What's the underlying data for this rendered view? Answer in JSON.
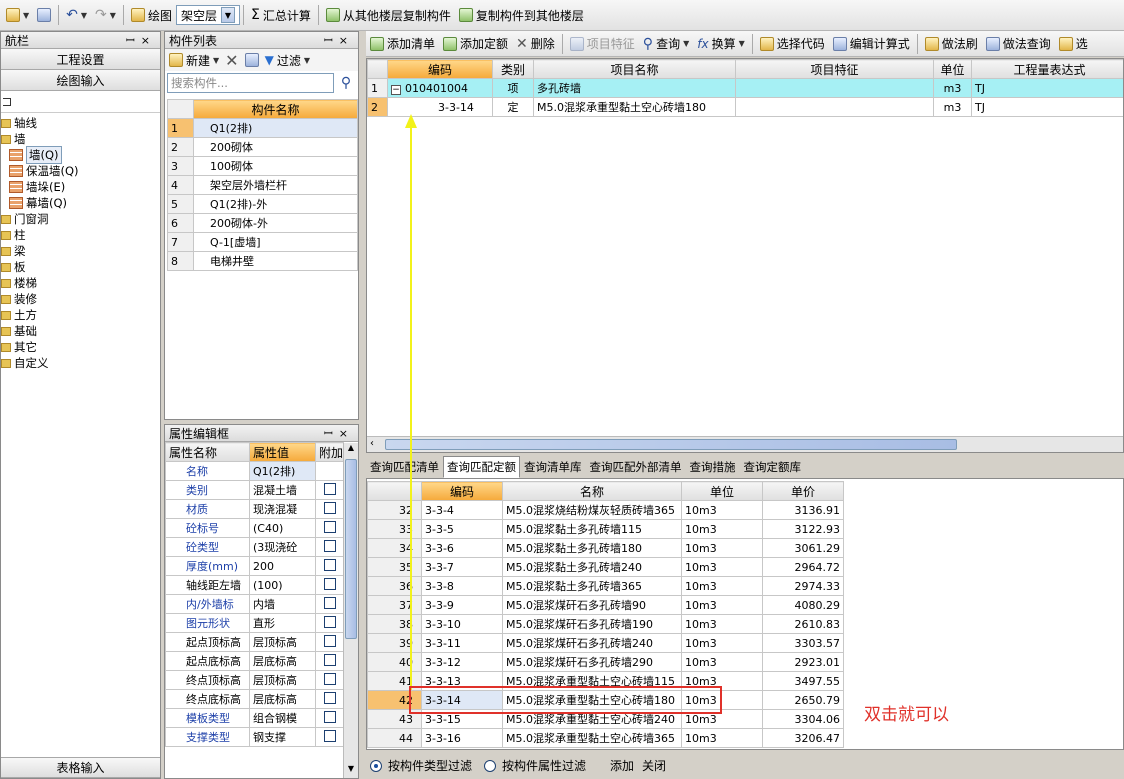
{
  "toolbar": {
    "draw_label": "绘图",
    "floor_value": "架空层",
    "sum_label": "汇总计算",
    "copy_from_label": "从其他楼层复制构件",
    "copy_to_label": "复制构件到其他楼层"
  },
  "nav": {
    "title": "航栏",
    "btn_project": "工程设置",
    "btn_draw": "绘图输入",
    "btn_table": "表格输入",
    "tree": [
      {
        "label": "轴线",
        "kind": "folder",
        "indent": 0
      },
      {
        "label": "墙",
        "kind": "folder",
        "indent": 0
      },
      {
        "label": "墙(Q)",
        "kind": "wall",
        "indent": 1,
        "selected": true
      },
      {
        "label": "保温墙(Q)",
        "kind": "wall",
        "indent": 1
      },
      {
        "label": "墙垛(E)",
        "kind": "wall",
        "indent": 1
      },
      {
        "label": "幕墙(Q)",
        "kind": "wall",
        "indent": 1
      },
      {
        "label": "门窗洞",
        "kind": "folder",
        "indent": 0
      },
      {
        "label": "柱",
        "kind": "folder",
        "indent": 0
      },
      {
        "label": "梁",
        "kind": "folder",
        "indent": 0
      },
      {
        "label": "板",
        "kind": "folder",
        "indent": 0
      },
      {
        "label": "楼梯",
        "kind": "folder",
        "indent": 0
      },
      {
        "label": "装修",
        "kind": "folder",
        "indent": 0
      },
      {
        "label": "土方",
        "kind": "folder",
        "indent": 0
      },
      {
        "label": "基础",
        "kind": "folder",
        "indent": 0
      },
      {
        "label": "其它",
        "kind": "folder",
        "indent": 0
      },
      {
        "label": "自定义",
        "kind": "folder",
        "indent": 0
      }
    ]
  },
  "complist": {
    "title": "构件列表",
    "new_label": "新建",
    "filter_label": "过滤",
    "search_placeholder": "搜索构件...",
    "header": "构件名称",
    "rows": [
      "Q1(2排)",
      "200砌体",
      "100砌体",
      "架空层外墙栏杆",
      "Q1(2排)-外",
      "200砌体-外",
      "Q-1[虚墙]",
      "电梯井壁"
    ]
  },
  "props": {
    "title": "属性编辑框",
    "headers": [
      "属性名称",
      "属性值",
      "附加"
    ],
    "rows": [
      {
        "name": "名称",
        "value": "Q1(2排)",
        "blue": true,
        "chk": false
      },
      {
        "name": "类别",
        "value": "混凝土墙",
        "blue": true,
        "chk": true
      },
      {
        "name": "材质",
        "value": "现浇混凝",
        "blue": true,
        "chk": true
      },
      {
        "name": "砼标号",
        "value": "(C40)",
        "blue": true,
        "chk": true
      },
      {
        "name": "砼类型",
        "value": "(3现浇砼",
        "blue": true,
        "chk": true
      },
      {
        "name": "厚度(mm)",
        "value": "200",
        "blue": true,
        "chk": true
      },
      {
        "name": "轴线距左墙",
        "value": "(100)",
        "blue": false,
        "chk": true
      },
      {
        "name": "内/外墙标",
        "value": "内墙",
        "blue": true,
        "chk": true
      },
      {
        "name": "图元形状",
        "value": "直形",
        "blue": true,
        "chk": true
      },
      {
        "name": "起点顶标高",
        "value": "层顶标高",
        "blue": false,
        "chk": true
      },
      {
        "name": "起点底标高",
        "value": "层底标高",
        "blue": false,
        "chk": true
      },
      {
        "name": "终点顶标高",
        "value": "层顶标高",
        "blue": false,
        "chk": true
      },
      {
        "name": "终点底标高",
        "value": "层底标高",
        "blue": false,
        "chk": true
      },
      {
        "name": "模板类型",
        "value": "组合钢模",
        "blue": true,
        "chk": true
      },
      {
        "name": "支撑类型",
        "value": "钢支撑",
        "blue": true,
        "chk": true
      }
    ]
  },
  "quota_toolbar": {
    "add_list": "添加清单",
    "add_quota": "添加定额",
    "delete": "删除",
    "item_feature": "项目特征",
    "query": "查询",
    "convert": "换算",
    "select_code": "选择代码",
    "edit_formula": "编辑计算式",
    "method_brush": "做法刷",
    "method_query": "做法查询",
    "select_more": "选"
  },
  "quota_grid": {
    "headers": [
      "编码",
      "类别",
      "项目名称",
      "项目特征",
      "单位",
      "工程量表达式"
    ],
    "rows": [
      {
        "n": "1",
        "code": "010401004",
        "type": "项",
        "name": "多孔砖墙",
        "feature": "",
        "unit": "m3",
        "expr": "TJ"
      },
      {
        "n": "2",
        "code": "3-3-14",
        "type": "定",
        "name": "M5.0混浆承重型黏土空心砖墙180",
        "feature": "",
        "unit": "m3",
        "expr": "TJ"
      }
    ]
  },
  "lower_tabs": [
    "查询匹配清单",
    "查询匹配定额",
    "查询清单库",
    "查询匹配外部清单",
    "查询措施",
    "查询定额库"
  ],
  "lower_grid": {
    "headers": [
      "编码",
      "名称",
      "单位",
      "单价"
    ],
    "rows": [
      {
        "n": "32",
        "code": "3-3-4",
        "name": "M5.0混浆烧结粉煤灰轻质砖墙365",
        "unit": "10m3",
        "price": "3136.91"
      },
      {
        "n": "33",
        "code": "3-3-5",
        "name": "M5.0混浆黏土多孔砖墙115",
        "unit": "10m3",
        "price": "3122.93"
      },
      {
        "n": "34",
        "code": "3-3-6",
        "name": "M5.0混浆黏土多孔砖墙180",
        "unit": "10m3",
        "price": "3061.29"
      },
      {
        "n": "35",
        "code": "3-3-7",
        "name": "M5.0混浆黏土多孔砖墙240",
        "unit": "10m3",
        "price": "2964.72"
      },
      {
        "n": "36",
        "code": "3-3-8",
        "name": "M5.0混浆黏土多孔砖墙365",
        "unit": "10m3",
        "price": "2974.33"
      },
      {
        "n": "37",
        "code": "3-3-9",
        "name": "M5.0混浆煤矸石多孔砖墙90",
        "unit": "10m3",
        "price": "4080.29"
      },
      {
        "n": "38",
        "code": "3-3-10",
        "name": "M5.0混浆煤矸石多孔砖墙190",
        "unit": "10m3",
        "price": "2610.83"
      },
      {
        "n": "39",
        "code": "3-3-11",
        "name": "M5.0混浆煤矸石多孔砖墙240",
        "unit": "10m3",
        "price": "3303.57"
      },
      {
        "n": "40",
        "code": "3-3-12",
        "name": "M5.0混浆煤矸石多孔砖墙290",
        "unit": "10m3",
        "price": "2923.01"
      },
      {
        "n": "41",
        "code": "3-3-13",
        "name": "M5.0混浆承重型黏土空心砖墙115",
        "unit": "10m3",
        "price": "3497.55"
      },
      {
        "n": "42",
        "code": "3-3-14",
        "name": "M5.0混浆承重型黏土空心砖墙180",
        "unit": "10m3",
        "price": "2650.79",
        "selected": true
      },
      {
        "n": "43",
        "code": "3-3-15",
        "name": "M5.0混浆承重型黏土空心砖墙240",
        "unit": "10m3",
        "price": "3304.06"
      },
      {
        "n": "44",
        "code": "3-3-16",
        "name": "M5.0混浆承重型黏土空心砖墙365",
        "unit": "10m3",
        "price": "3206.47"
      }
    ]
  },
  "bottom_bar": {
    "radio_type": "按构件类型过滤",
    "radio_attr": "按构件属性过滤",
    "add": "添加",
    "close": "关闭"
  },
  "annotation": {
    "text": "双击就可以",
    "color": "#e0312a"
  },
  "colors": {
    "arrow": "#f2f21a",
    "highlight_box": "#e0312a",
    "selected_row": "#a6f0f4"
  }
}
